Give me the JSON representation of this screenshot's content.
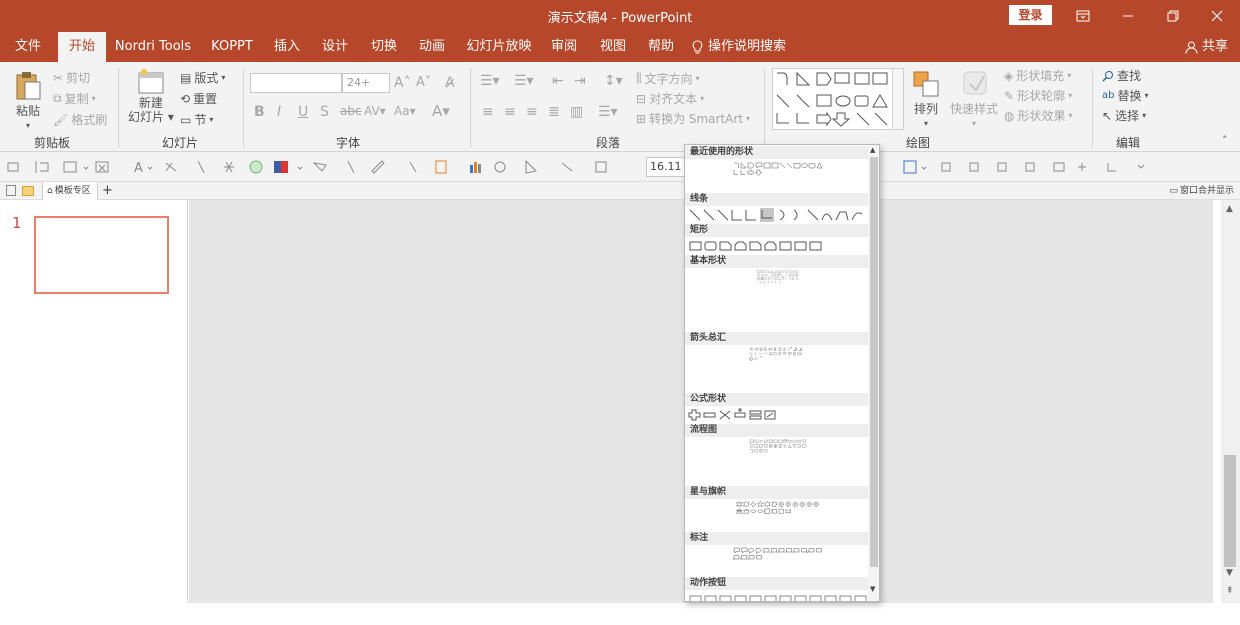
{
  "window": {
    "title": "演示文稿4  -  PowerPoint",
    "login": "登录"
  },
  "tabs": [
    {
      "label": "文件"
    },
    {
      "label": "开始",
      "active": true
    },
    {
      "label": "Nordri Tools"
    },
    {
      "label": "KOPPT"
    },
    {
      "label": "插入"
    },
    {
      "label": "设计"
    },
    {
      "label": "切换"
    },
    {
      "label": "动画"
    },
    {
      "label": "幻灯片放映"
    },
    {
      "label": "审阅"
    },
    {
      "label": "视图"
    },
    {
      "label": "帮助"
    }
  ],
  "tell_me": "操作说明搜索",
  "share": "共享",
  "ribbon": {
    "clipboard": {
      "label": "剪贴板",
      "paste": "粘贴",
      "cut": "剪切",
      "copy": "复制",
      "format_painter": "格式刷"
    },
    "slides": {
      "label": "幻灯片",
      "new_slide_line1": "新建",
      "new_slide_line2": "幻灯片",
      "layout": "版式",
      "reset": "重置",
      "section": "节"
    },
    "font": {
      "label": "字体",
      "font_name": "",
      "font_size": "24+"
    },
    "paragraph": {
      "label": "段落",
      "text_direction": "文字方向",
      "align_text": "对齐文本",
      "convert_smartart": "转换为 SmartArt"
    },
    "drawing": {
      "label": "绘图",
      "arrange": "排列",
      "quick_styles": "快速样式",
      "shape_fill": "形状填充",
      "shape_outline": "形状轮廓",
      "shape_effects": "形状效果"
    },
    "editing": {
      "label": "编辑",
      "find": "查找",
      "replace": "替换",
      "select": "选择"
    }
  },
  "qat": {
    "zoom": "16.11"
  },
  "strip": {
    "template_area": "模板专区",
    "window_merge": "窗口合并显示"
  },
  "thumbnails": [
    {
      "number": "1"
    }
  ],
  "gallery": {
    "sections": [
      "最近使用的形状",
      "线条",
      "矩形",
      "基本形状",
      "箭头总汇",
      "公式形状",
      "流程图",
      "星与旗帜",
      "标注",
      "动作按钮"
    ]
  },
  "colors": {
    "brand": "#b7472a",
    "ribbon_bg": "#f3f3f3",
    "slide_border": "#e8806b",
    "canvas": "#e6e6e6"
  }
}
